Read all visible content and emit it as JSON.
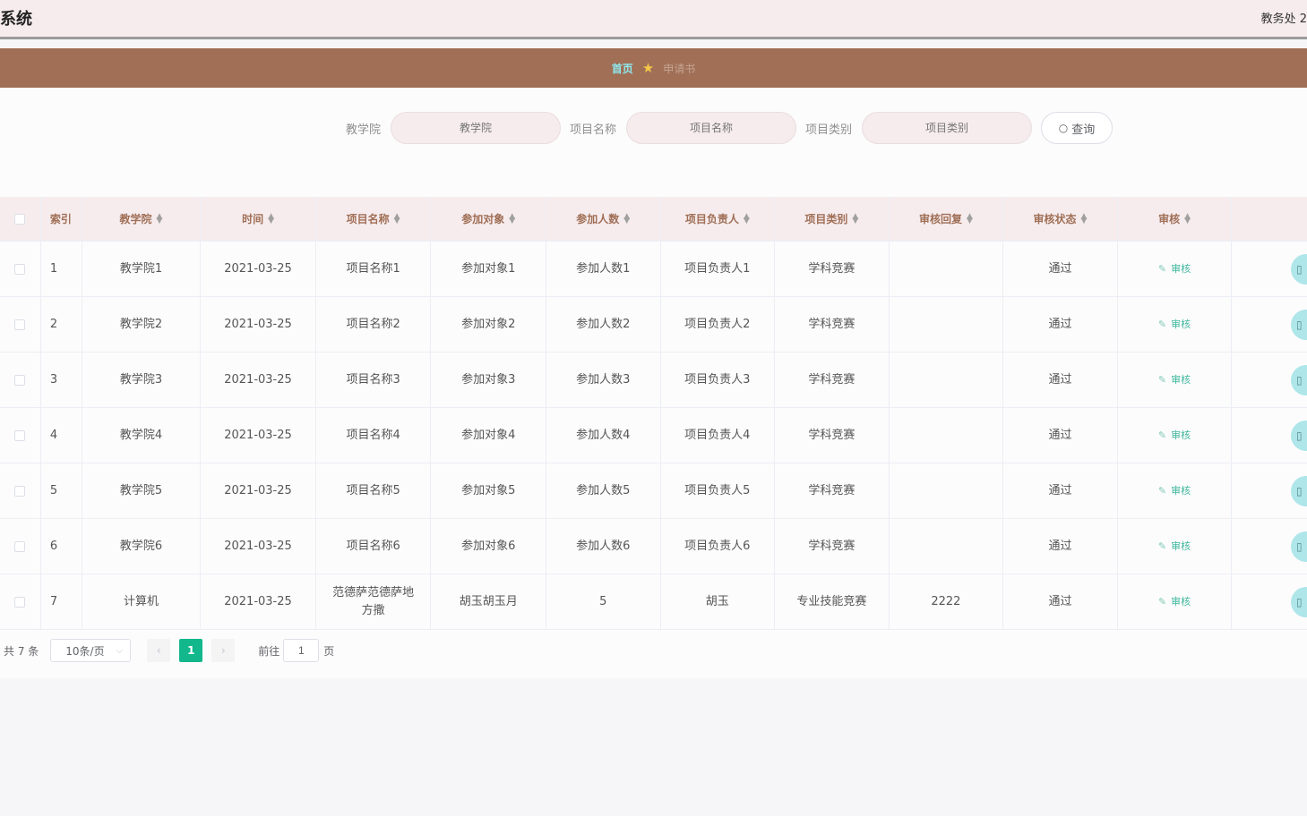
{
  "header": {
    "title": "系统",
    "user": "教务处 2"
  },
  "nav": {
    "home": "首页",
    "current": "申请书"
  },
  "search": {
    "college_label": "教学院",
    "college_placeholder": "教学院",
    "project_label": "项目名称",
    "project_placeholder": "项目名称",
    "category_label": "项目类别",
    "category_placeholder": "项目类别",
    "query_label": "查询"
  },
  "table": {
    "columns": [
      "索引",
      "教学院",
      "时间",
      "项目名称",
      "参加对象",
      "参加人数",
      "项目负责人",
      "项目类别",
      "审核回复",
      "审核状态",
      "审核"
    ],
    "review_action": "审核",
    "rows": [
      {
        "index": "1",
        "college": "教学院1",
        "time": "2021-03-25",
        "project": "项目名称1",
        "target": "参加对象1",
        "count": "参加人数1",
        "leader": "项目负责人1",
        "category": "学科竞赛",
        "reply": "",
        "status": "通过"
      },
      {
        "index": "2",
        "college": "教学院2",
        "time": "2021-03-25",
        "project": "项目名称2",
        "target": "参加对象2",
        "count": "参加人数2",
        "leader": "项目负责人2",
        "category": "学科竞赛",
        "reply": "",
        "status": "通过"
      },
      {
        "index": "3",
        "college": "教学院3",
        "time": "2021-03-25",
        "project": "项目名称3",
        "target": "参加对象3",
        "count": "参加人数3",
        "leader": "项目负责人3",
        "category": "学科竞赛",
        "reply": "",
        "status": "通过"
      },
      {
        "index": "4",
        "college": "教学院4",
        "time": "2021-03-25",
        "project": "项目名称4",
        "target": "参加对象4",
        "count": "参加人数4",
        "leader": "项目负责人4",
        "category": "学科竞赛",
        "reply": "",
        "status": "通过"
      },
      {
        "index": "5",
        "college": "教学院5",
        "time": "2021-03-25",
        "project": "项目名称5",
        "target": "参加对象5",
        "count": "参加人数5",
        "leader": "项目负责人5",
        "category": "学科竞赛",
        "reply": "",
        "status": "通过"
      },
      {
        "index": "6",
        "college": "教学院6",
        "time": "2021-03-25",
        "project": "项目名称6",
        "target": "参加对象6",
        "count": "参加人数6",
        "leader": "项目负责人6",
        "category": "学科竞赛",
        "reply": "",
        "status": "通过"
      },
      {
        "index": "7",
        "college": "计算机",
        "time": "2021-03-25",
        "project": "范德萨范德萨地方撒",
        "target": "胡玉胡玉月",
        "count": "5",
        "leader": "胡玉",
        "category": "专业技能竞赛",
        "reply": "2222",
        "status": "通过"
      }
    ]
  },
  "pagination": {
    "total": "共 7 条",
    "page_size": "10条/页",
    "current_page": "1",
    "goto_label": "前往",
    "goto_value": "1",
    "page_suffix": "页"
  },
  "colors": {
    "accent_nav": "#a06f56",
    "header_bg": "#f6ecee",
    "page_active": "#12b78c",
    "review_link": "#3eb79d"
  }
}
